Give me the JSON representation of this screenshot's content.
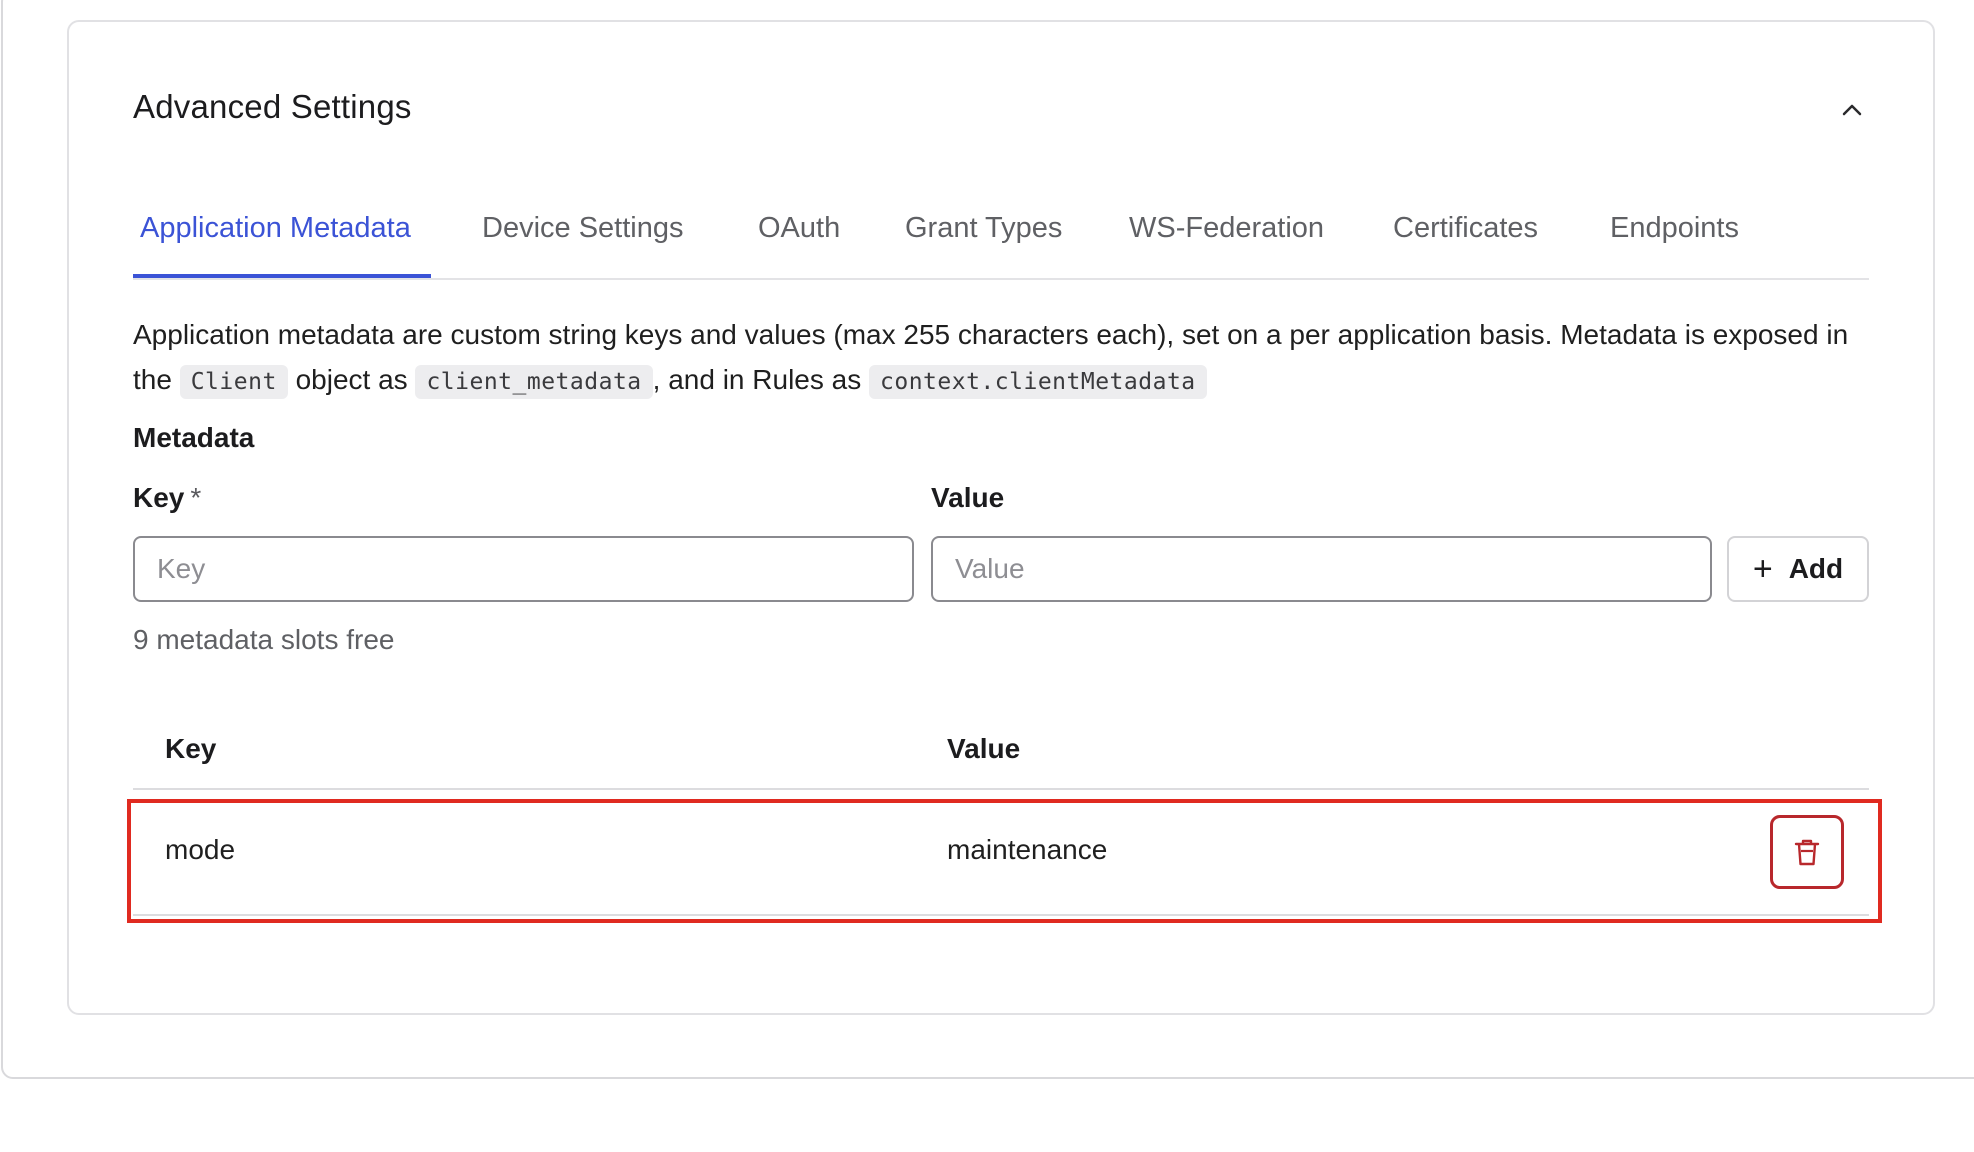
{
  "section": {
    "title": "Advanced Settings",
    "collapse_icon": "chevron-up-icon"
  },
  "tabs": [
    {
      "label": "Application Metadata",
      "active": true
    },
    {
      "label": "Device Settings",
      "active": false
    },
    {
      "label": "OAuth",
      "active": false
    },
    {
      "label": "Grant Types",
      "active": false
    },
    {
      "label": "WS-Federation",
      "active": false
    },
    {
      "label": "Certificates",
      "active": false
    },
    {
      "label": "Endpoints",
      "active": false
    }
  ],
  "description": {
    "text_1": "Application metadata are custom string keys and values (max 255 characters each), set on a per application basis. Metadata is exposed in the ",
    "code_1": "Client",
    "text_2": " object as ",
    "code_2": "client_metadata",
    "text_3": ", and in Rules as ",
    "code_3": "context.clientMetadata"
  },
  "metadata_form": {
    "heading": "Metadata",
    "key_label": "Key",
    "required_mark": "*",
    "key_placeholder": "Key",
    "key_value": "",
    "value_label": "Value",
    "value_placeholder": "Value",
    "value_value": "",
    "add_label": "Add",
    "add_icon": "plus-icon",
    "slots_free": "9 metadata slots free"
  },
  "metadata_table": {
    "headers": {
      "key": "Key",
      "value": "Value"
    },
    "rows": [
      {
        "key": "mode",
        "value": "maintenance",
        "delete_icon": "trash-icon"
      }
    ]
  },
  "colors": {
    "accent": "#3b53d6",
    "danger": "#b8282c",
    "highlight": "#e02a20"
  }
}
